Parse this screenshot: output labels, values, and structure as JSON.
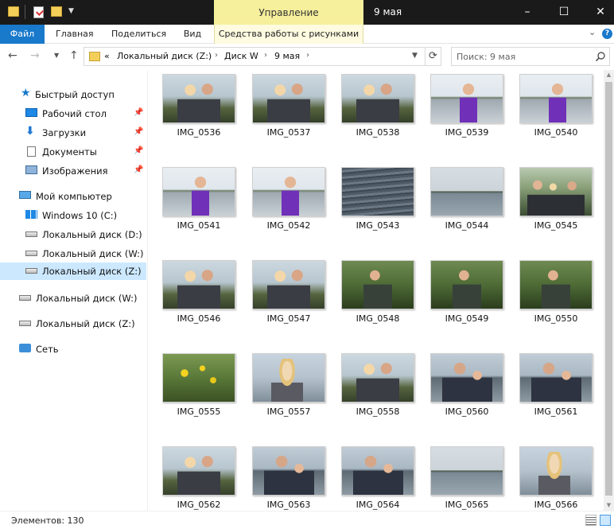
{
  "window": {
    "title": "9 мая",
    "contextual_tab": "Управление",
    "controls": {
      "minimize": "–",
      "maximize": "☐",
      "close": "✕"
    }
  },
  "ribbon": {
    "tabs": [
      "Файл",
      "Главная",
      "Поделиться",
      "Вид",
      "Средства работы с рисунками"
    ],
    "file_tab_color": "#1979ca",
    "contextual_color": "#f6ef9b"
  },
  "address": {
    "prefix": "«",
    "breadcrumb": [
      "Локальный диск (Z:)",
      "Диск W",
      "9 мая"
    ],
    "search_placeholder": "Поиск: 9 мая"
  },
  "sidebar": {
    "items": [
      {
        "label": "Быстрый доступ",
        "icon": "star-icon",
        "pinned": false
      },
      {
        "label": "Рабочий стол",
        "icon": "desktop-icon",
        "pinned": true
      },
      {
        "label": "Загрузки",
        "icon": "download-icon",
        "pinned": true
      },
      {
        "label": "Документы",
        "icon": "documents-icon",
        "pinned": true
      },
      {
        "label": "Изображения",
        "icon": "pictures-icon",
        "pinned": true
      },
      {
        "label": "Мой компьютер",
        "icon": "computer-icon",
        "pinned": false
      },
      {
        "label": "Windows 10 (C:)",
        "icon": "windows-drive-icon",
        "pinned": false
      },
      {
        "label": "Локальный диск (D:)",
        "icon": "drive-icon",
        "pinned": false
      },
      {
        "label": "Локальный диск (W:)",
        "icon": "drive-icon",
        "pinned": false
      },
      {
        "label": "Локальный диск (Z:)",
        "icon": "drive-icon",
        "pinned": false,
        "selected": true
      },
      {
        "label": "Локальный диск (W:)",
        "icon": "drive-icon",
        "pinned": false
      },
      {
        "label": "Локальный диск (Z:)",
        "icon": "drive-icon",
        "pinned": false
      },
      {
        "label": "Сеть",
        "icon": "network-icon",
        "pinned": false
      }
    ]
  },
  "files": [
    "IMG_0536",
    "IMG_0537",
    "IMG_0538",
    "IMG_0539",
    "IMG_0540",
    "IMG_0541",
    "IMG_0542",
    "IMG_0543",
    "IMG_0544",
    "IMG_0545",
    "IMG_0546",
    "IMG_0547",
    "IMG_0548",
    "IMG_0549",
    "IMG_0550",
    "IMG_0555",
    "IMG_0557",
    "IMG_0558",
    "IMG_0560",
    "IMG_0561",
    "IMG_0562",
    "IMG_0563",
    "IMG_0564",
    "IMG_0565",
    "IMG_0566"
  ],
  "status": {
    "text": "Элементов: 130"
  }
}
